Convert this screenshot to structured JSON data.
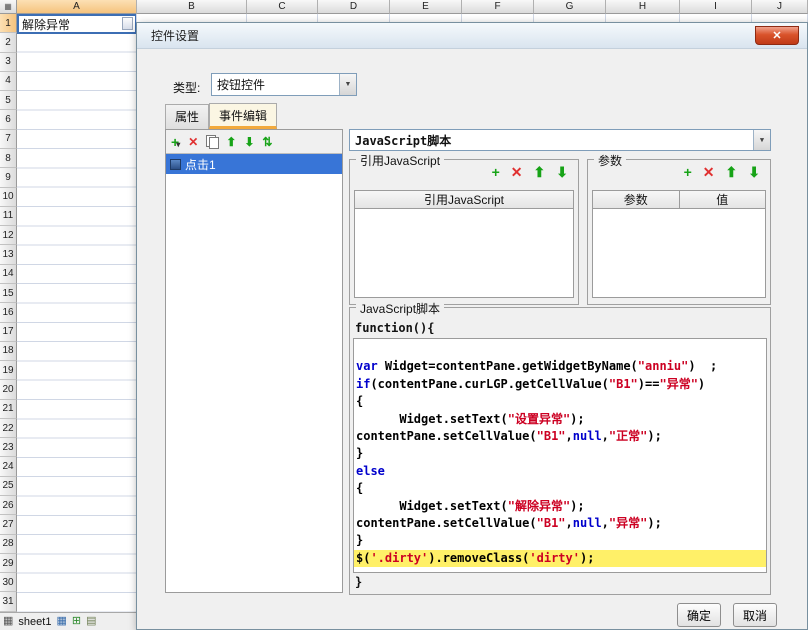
{
  "spreadsheet": {
    "columns": [
      "A",
      "B",
      "C",
      "D",
      "E",
      "F",
      "G",
      "H",
      "I",
      "J"
    ],
    "rows": [
      "1",
      "2",
      "3",
      "4",
      "5",
      "6",
      "7",
      "8",
      "9",
      "10",
      "11",
      "12",
      "13",
      "14",
      "15",
      "16",
      "17",
      "18",
      "19",
      "20",
      "21",
      "22",
      "23",
      "24",
      "25",
      "26",
      "27",
      "28",
      "29",
      "30",
      "31"
    ],
    "active_cell": {
      "ref": "A1",
      "value": "解除异常"
    },
    "sheet_tab": "sheet1"
  },
  "dialog": {
    "title": "控件设置",
    "type_label": "类型:",
    "type_value": "按钮控件",
    "tabs": {
      "properties": "属性",
      "events": "事件编辑"
    },
    "event_item": "点击1",
    "script_type_value": "JavaScript脚本",
    "ref_js": {
      "legend": "引用JavaScript",
      "table_header": "引用JavaScript"
    },
    "params": {
      "legend": "参数",
      "col_param": "参数",
      "col_value": "值"
    },
    "script": {
      "legend": "JavaScript脚本",
      "open_line": "function(){",
      "close_line": "}",
      "lines": [
        {
          "t": []
        },
        {
          "t": [
            [
              "k",
              "var"
            ],
            [
              "p",
              " Widget=contentPane.getWidgetByName("
            ],
            [
              "s",
              "\"anniu\""
            ],
            [
              "p",
              ")  ;"
            ]
          ]
        },
        {
          "t": [
            [
              "k",
              "if"
            ],
            [
              "p",
              "(contentPane.curLGP.getCellValue("
            ],
            [
              "s",
              "\"B1\""
            ],
            [
              "p",
              ")=="
            ],
            [
              "s",
              "\"异常\""
            ],
            [
              "p",
              ")"
            ]
          ]
        },
        {
          "t": [
            [
              "p",
              "{"
            ]
          ]
        },
        {
          "t": [
            [
              "p",
              "      Widget.setText("
            ],
            [
              "s",
              "\"设置异常\""
            ],
            [
              "p",
              ");"
            ]
          ]
        },
        {
          "t": [
            [
              "p",
              "contentPane.setCellValue("
            ],
            [
              "s",
              "\"B1\""
            ],
            [
              "p",
              ","
            ],
            [
              "k",
              "null"
            ],
            [
              "p",
              ","
            ],
            [
              "s",
              "\"正常\""
            ],
            [
              "p",
              ");"
            ]
          ]
        },
        {
          "t": [
            [
              "p",
              "}"
            ]
          ]
        },
        {
          "t": [
            [
              "k",
              "else"
            ]
          ]
        },
        {
          "t": [
            [
              "p",
              "{"
            ]
          ]
        },
        {
          "t": [
            [
              "p",
              "      Widget.setText("
            ],
            [
              "s",
              "\"解除异常\""
            ],
            [
              "p",
              ");"
            ]
          ]
        },
        {
          "t": [
            [
              "p",
              "contentPane.setCellValue("
            ],
            [
              "s",
              "\"B1\""
            ],
            [
              "p",
              ","
            ],
            [
              "k",
              "null"
            ],
            [
              "p",
              ","
            ],
            [
              "s",
              "\"异常\""
            ],
            [
              "p",
              ");"
            ]
          ]
        },
        {
          "t": [
            [
              "p",
              "}"
            ]
          ]
        },
        {
          "hl": true,
          "t": [
            [
              "p",
              "$("
            ],
            [
              "s",
              "'.dirty'"
            ],
            [
              "p",
              ").removeClass("
            ],
            [
              "s",
              "'dirty'"
            ],
            [
              "p",
              ");"
            ]
          ]
        }
      ]
    },
    "ok": "确定",
    "cancel": "取消"
  },
  "icons": {
    "close": "✕",
    "dropdown": "▼",
    "plus": "+",
    "delete": "✕",
    "up": "⬆",
    "down": "⬇",
    "sort": "⇅",
    "caret": "▾",
    "corner": "▦",
    "sheet_grid": "▦",
    "sheet_blue": "▦",
    "sheet_add": "⊞",
    "sheet_page": "▤"
  }
}
